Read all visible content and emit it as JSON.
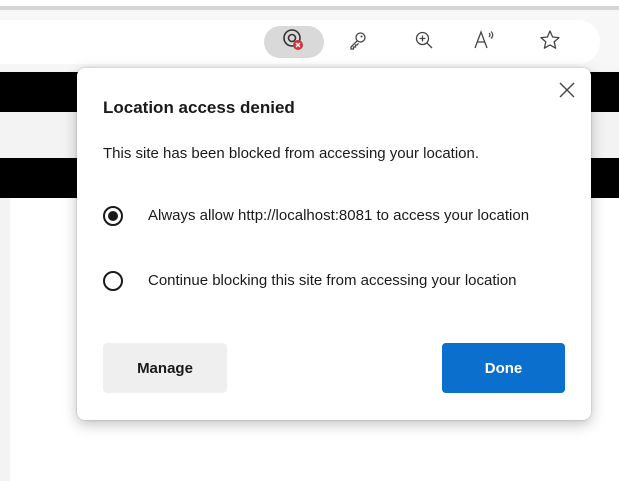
{
  "toolbar": {
    "icons": [
      "location-blocked-icon",
      "key-icon",
      "zoom-in-icon",
      "read-aloud-icon",
      "favorite-star-icon"
    ]
  },
  "dialog": {
    "title": "Location access denied",
    "description": "This site has been blocked from accessing your location.",
    "options": [
      {
        "label": "Always allow http://localhost:8081 to access your location",
        "selected": true
      },
      {
        "label": "Continue blocking this site from accessing your location",
        "selected": false
      }
    ],
    "manage_label": "Manage",
    "done_label": "Done"
  },
  "colors": {
    "accent": "#0b6fce",
    "blocked_badge": "#d13438"
  }
}
